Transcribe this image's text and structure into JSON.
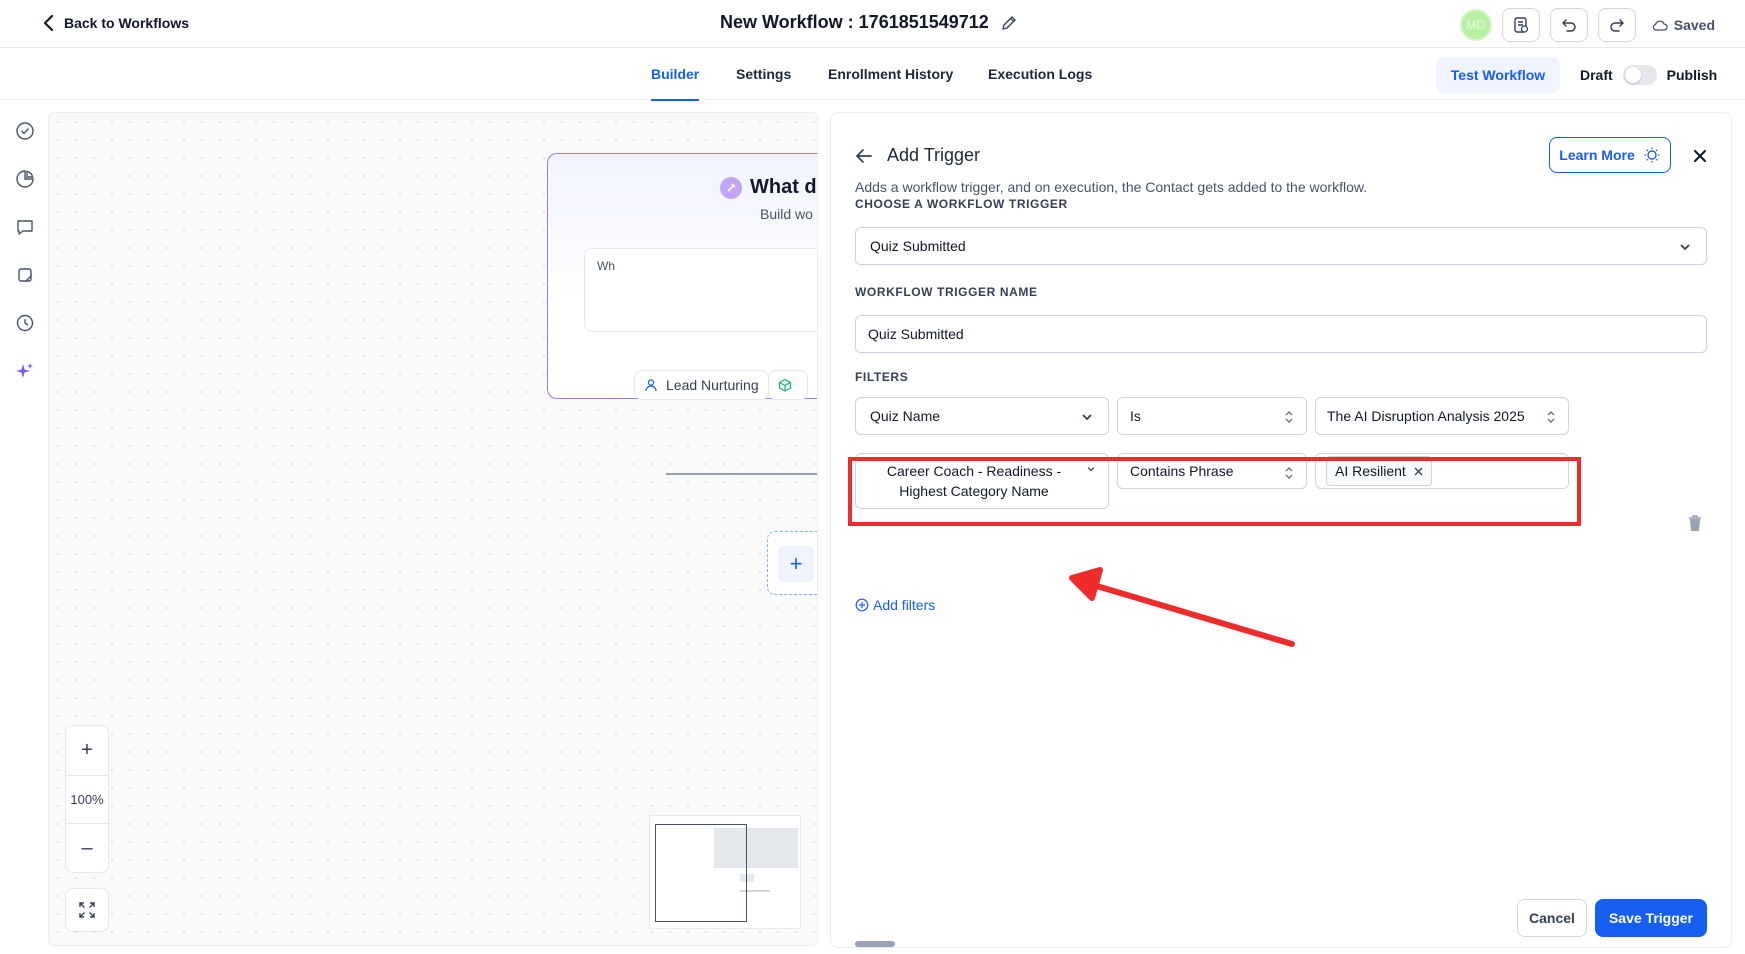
{
  "header": {
    "back_label": "Back to Workflows",
    "workflow_title": "New Workflow : 1761851549712",
    "avatar_initials": "MD",
    "saved_label": "Saved"
  },
  "tabs": [
    {
      "label": "Builder",
      "active": true
    },
    {
      "label": "Settings",
      "active": false
    },
    {
      "label": "Enrollment History",
      "active": false
    },
    {
      "label": "Execution Logs",
      "active": false
    }
  ],
  "actions": {
    "test_workflow": "Test Workflow",
    "draft_label": "Draft",
    "publish_label": "Publish"
  },
  "sidebar_icons": [
    "check-circle-icon",
    "pie-chart-icon",
    "message-icon",
    "note-icon",
    "history-icon",
    "sparkle-icon"
  ],
  "canvas": {
    "node": {
      "heading": "What d",
      "subtitle": "Build wo",
      "input_text": "Wh",
      "chip_label": "Lead Nurturing"
    },
    "zoom_level": "100%"
  },
  "panel": {
    "title": "Add Trigger",
    "description": "Adds a workflow trigger, and on execution, the Contact gets added to the workflow.",
    "learn_more": "Learn More",
    "choose_trigger_label": "CHOOSE A WORKFLOW TRIGGER",
    "trigger_value": "Quiz Submitted",
    "trigger_name_label": "WORKFLOW TRIGGER NAME",
    "trigger_name_value": "Quiz Submitted",
    "filters_label": "FILTERS",
    "filters": [
      {
        "field": "Quiz Name",
        "operator": "Is",
        "value": "The AI Disruption Analysis 2025"
      },
      {
        "field": "Career Coach - Readiness - Highest Category Name",
        "operator": "Contains Phrase",
        "value": "AI Resilient"
      }
    ],
    "add_filters": "Add filters",
    "cancel": "Cancel",
    "save": "Save Trigger"
  },
  "colors": {
    "accent": "#155eef",
    "highlight": "#ef2b2b",
    "node_border": "#9e77ed"
  }
}
